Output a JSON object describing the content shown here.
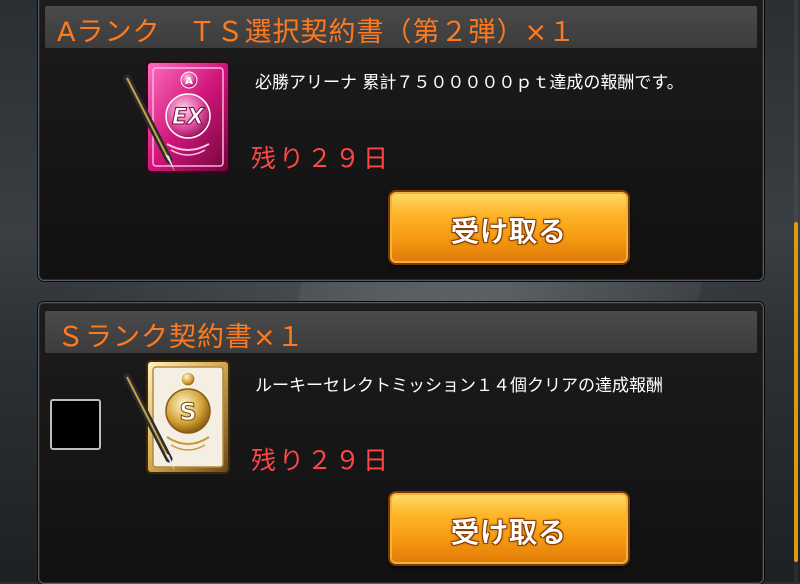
{
  "rewards": [
    {
      "title": "Aランク　ＴＳ選択契約書（第２弾）×１",
      "description": "必勝アリーナ 累計７５０００００ｐｔ達成の報酬です。",
      "remaining": "残り２９日",
      "button_label": "受け取る",
      "icon": "ex-contract-icon",
      "icon_badge": "EX",
      "icon_emblem": "A",
      "accent_color": "#e0288e"
    },
    {
      "title": "Ｓランク契約書×１",
      "description": "ルーキーセレクトミッション１４個クリアの達成報酬",
      "remaining": "残り２９日",
      "button_label": "受け取る",
      "icon": "s-rank-contract-icon",
      "icon_emblem": "S",
      "accent_color": "#c99a3a",
      "checkbox_checked": false
    }
  ],
  "colors": {
    "title": "#ff7a1f",
    "remaining": "#ff4646",
    "button": "#f59a10",
    "scroll_thumb": "#d99a16"
  }
}
